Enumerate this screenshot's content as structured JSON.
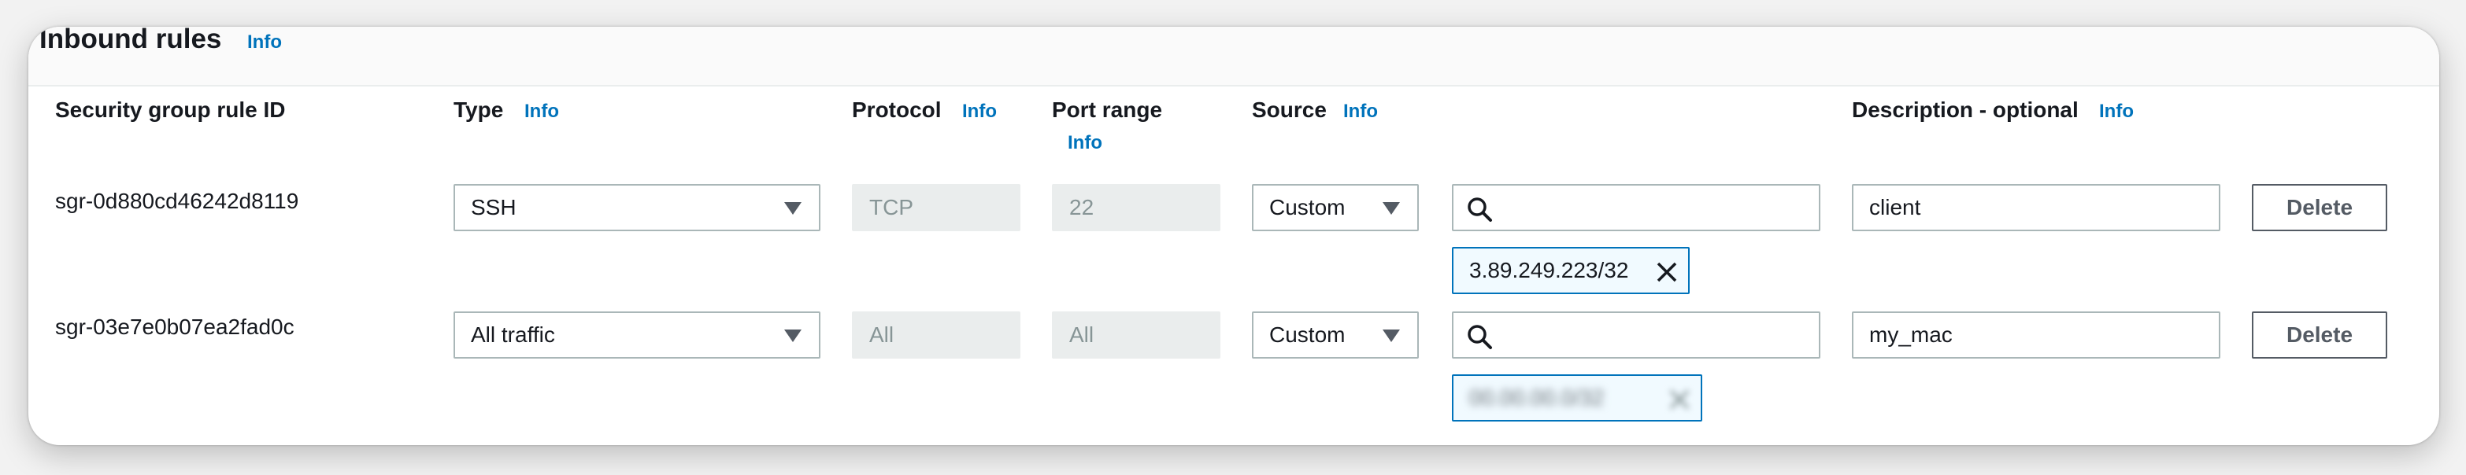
{
  "section": {
    "title": "Inbound rules",
    "info": "Info"
  },
  "columns": {
    "rule_id": "Security group rule ID",
    "type": "Type",
    "type_info": "Info",
    "protocol": "Protocol",
    "protocol_info": "Info",
    "port_range": "Port range",
    "port_range_info": "Info",
    "source": "Source",
    "source_info": "Info",
    "description": "Description - optional",
    "description_info": "Info"
  },
  "rows": [
    {
      "rule_id": "sgr-0d880cd46242d8119",
      "type": "SSH",
      "protocol": "TCP",
      "port_range": "22",
      "source_type": "Custom",
      "source_search": "",
      "source_token": "3.89.249.223/32",
      "description": "client",
      "delete_label": "Delete"
    },
    {
      "rule_id": "sgr-03e7e0b07ea2fad0c",
      "type": "All traffic",
      "protocol": "All",
      "port_range": "All",
      "source_type": "Custom",
      "source_search": "",
      "source_token": "00.00.00.0/32",
      "description": "my_mac",
      "delete_label": "Delete"
    }
  ],
  "icons": {
    "dropdown": "caret-down-icon",
    "search": "search-icon",
    "remove": "close-icon"
  },
  "colors": {
    "link": "#0073bb",
    "token_border": "#0073bb",
    "token_bg": "#f1faff",
    "disabled_bg": "#eaeded",
    "button_border": "#545b64"
  }
}
